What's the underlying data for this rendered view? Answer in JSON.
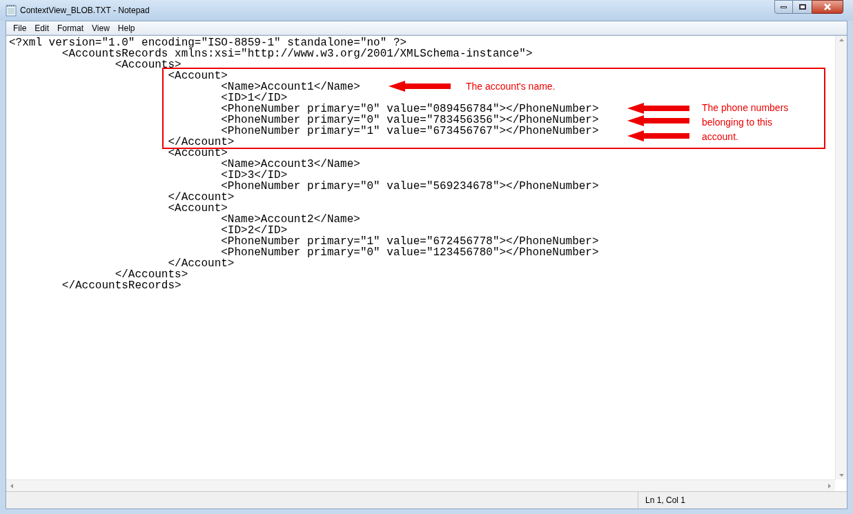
{
  "window": {
    "title": "ContextView_BLOB.TXT - Notepad"
  },
  "menu": [
    "File",
    "Edit",
    "Format",
    "View",
    "Help"
  ],
  "editor": {
    "lines": [
      "<?xml version=\"1.0\" encoding=\"ISO-8859-1\" standalone=\"no\" ?>",
      "\t<AccountsRecords xmlns:xsi=\"http://www.w3.org/2001/XMLSchema-instance\">",
      "\t\t<Accounts>",
      "\t\t\t<Account>",
      "\t\t\t\t<Name>Account1</Name>",
      "\t\t\t\t<ID>1</ID>",
      "\t\t\t\t<PhoneNumber primary=\"0\" value=\"089456784\"></PhoneNumber>",
      "\t\t\t\t<PhoneNumber primary=\"0\" value=\"783456356\"></PhoneNumber>",
      "\t\t\t\t<PhoneNumber primary=\"1\" value=\"673456767\"></PhoneNumber>",
      "\t\t\t</Account>",
      "\t\t\t<Account>",
      "\t\t\t\t<Name>Account3</Name>",
      "\t\t\t\t<ID>3</ID>",
      "\t\t\t\t<PhoneNumber primary=\"0\" value=\"569234678\"></PhoneNumber>",
      "\t\t\t</Account>",
      "\t\t\t<Account>",
      "\t\t\t\t<Name>Account2</Name>",
      "\t\t\t\t<ID>2</ID>",
      "\t\t\t\t<PhoneNumber primary=\"1\" value=\"672456778\"></PhoneNumber>",
      "\t\t\t\t<PhoneNumber primary=\"0\" value=\"123456780\"></PhoneNumber>",
      "\t\t\t</Account>",
      "\t\t</Accounts>",
      "\t</AccountsRecords>"
    ]
  },
  "annotations": [
    {
      "text": "The account's name."
    },
    {
      "text": "The phone numbers belonging to this account."
    }
  ],
  "status_bar": {
    "position": "Ln 1, Col 1"
  }
}
